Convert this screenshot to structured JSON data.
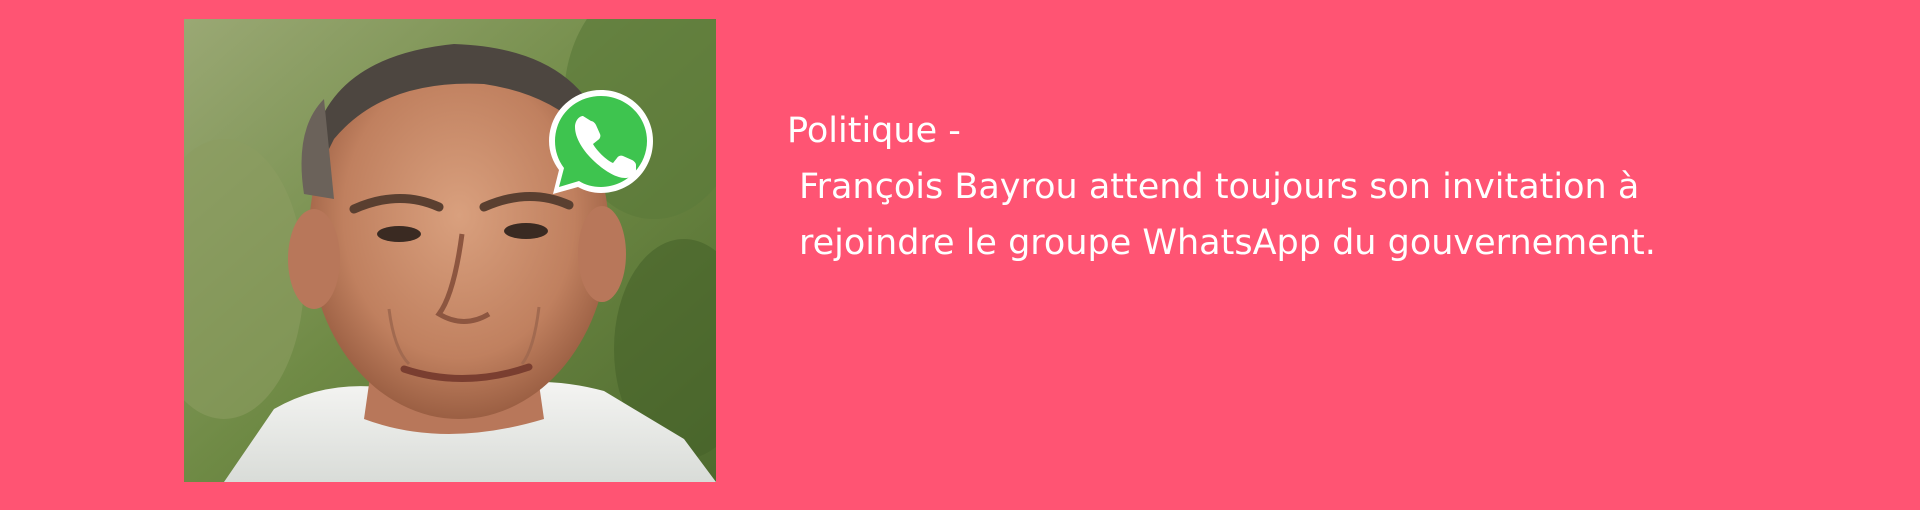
{
  "colors": {
    "background": "#ff5473",
    "text": "#ffffff",
    "whatsapp_green": "#3ec44f"
  },
  "article": {
    "category": "Politique -",
    "headline_line1": "François Bayrou attend toujours son invitation à",
    "headline_line2": "rejoindre le groupe WhatsApp du gouvernement."
  },
  "photo": {
    "subject": "portrait photo of a middle-aged man"
  },
  "badge": {
    "icon": "whatsapp-icon"
  }
}
